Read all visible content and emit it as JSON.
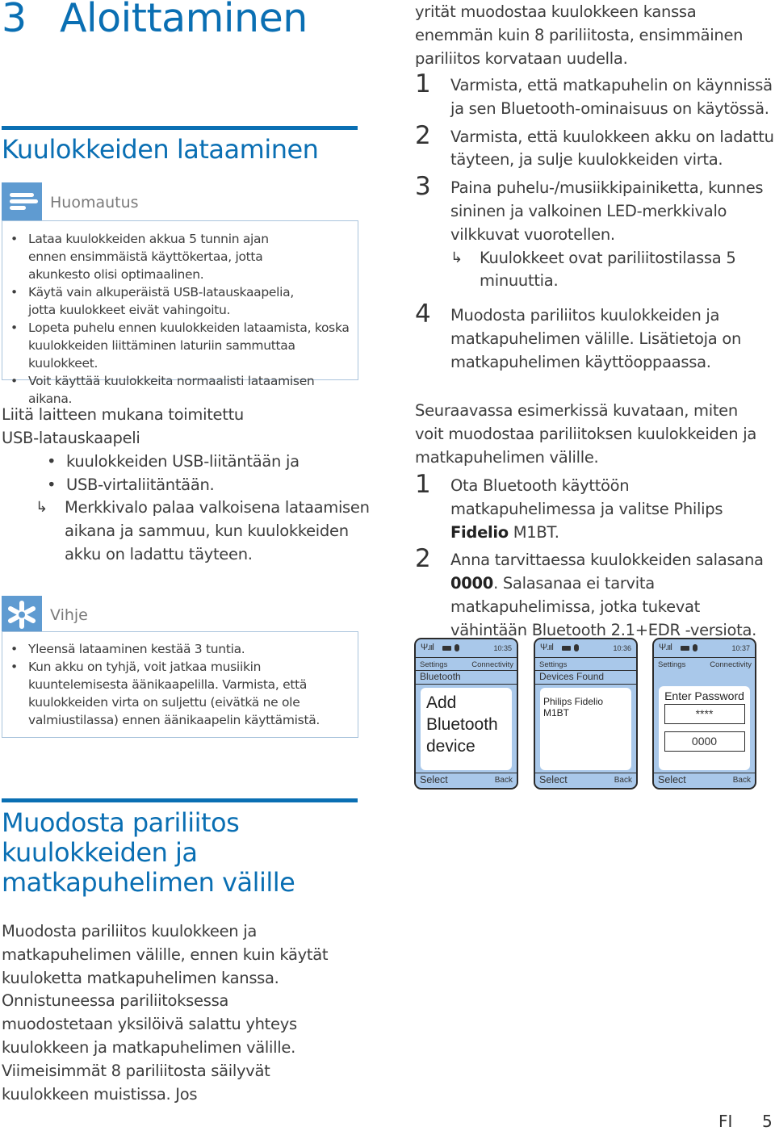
{
  "chapter": {
    "number": "3",
    "title": "Aloittaminen"
  },
  "accent_color": "#0a6fb3",
  "charging": {
    "heading": "Kuulokkeiden lataaminen",
    "note": {
      "icon": "note-lines-icon",
      "label": "Huomautus",
      "items": [
        "Lataa kuulokkeiden akkua 5 tunnin ajan ennen ensimmäistä käyttökertaa, jotta akunkesto olisi optimaalinen.",
        "Käytä vain alkuperäistä USB-latauskaapelia, jotta kuulokkeet eivät vahingoitu.",
        "Lopeta puhelu ennen kuulokkeiden lataamista, koska kuulokkeiden liittäminen laturiin sammuttaa kuulokkeet.",
        "Voit käyttää kuulokkeita normaalisti lataamisen aikana."
      ]
    },
    "intro": "Liitä laitteen mukana toimitettu USB-latauskaapeli",
    "bullets": [
      "kuulokkeiden USB-liitäntään ja",
      "USB-virtaliitäntään."
    ],
    "result": "Merkkivalo palaa valkoisena lataamisen aikana ja sammuu, kun kuulokkeiden akku on ladattu täyteen.",
    "tip": {
      "icon": "asterisk-tip-icon",
      "label": "Vihje",
      "items": [
        "Yleensä lataaminen kestää 3 tuntia.",
        "Kun akku on tyhjä, voit jatkaa musiikin kuuntelemisesta äänikaapelilla. Varmista, että kuulokkeiden virta on suljettu (eivätkä ne ole valmiustilassa) ennen äänikaapelin käyttämistä."
      ]
    }
  },
  "pairing": {
    "heading": "Muodosta pariliitos kuulokkeiden ja matkapuhelimen välille",
    "intro": "Muodosta pariliitos kuulokkeen ja matkapuhelimen välille, ennen kuin käytät kuuloketta matkapuhelimen kanssa. Onnistuneessa pariliitoksessa muodostetaan yksilöivä salattu yhteys kuulokkeen ja matkapuhelimen välille. Viimeisimmät 8 pariliitosta säilyvät kuulokkeen muistissa. Jos",
    "continuation": "yrität muodostaa kuulokkeen kanssa enemmän kuin 8 pariliitosta, ensimmäinen pariliitos korvataan uudella.",
    "steps": [
      {
        "n": "1",
        "text": "Varmista, että matkapuhelin on käynnissä ja sen Bluetooth-ominaisuus on käytössä."
      },
      {
        "n": "2",
        "text": "Varmista, että kuulokkeen akku on ladattu täyteen, ja sulje kuulokkeiden virta."
      },
      {
        "n": "3",
        "text": "Paina puhelu-/musiikkipainiketta, kunnes sininen ja valkoinen LED-merkkivalo vilkkuvat vuorotellen.",
        "result": "Kuulokkeet ovat pariliitostilassa 5 minuuttia."
      },
      {
        "n": "4",
        "text": "Muodosta pariliitos kuulokkeiden ja matkapuhelimen välille. Lisätietoja on matkapuhelimen käyttöoppaassa."
      }
    ],
    "example_intro": "Seuraavassa esimerkissä kuvataan, miten voit muodostaa pariliitoksen kuulokkeiden ja matkapuhelimen välille.",
    "example_steps": [
      {
        "n": "1",
        "pre": "Ota Bluetooth käyttöön matkapuhelimessa ja valitse Philips ",
        "bold": "Fidelio",
        "post": " M1BT."
      },
      {
        "n": "2",
        "pre": "Anna tarvittaessa kuulokkeiden salasana ",
        "bold": "0000",
        "post": ". Salasanaa ei tarvita matkapuhelimissa, jotka tukevat vähintään Bluetooth 2.1+EDR -versiota."
      }
    ]
  },
  "phones": [
    {
      "time": "10:35",
      "menu_left": "Settings",
      "menu_right": "Connectivity",
      "sub": "Bluetooth",
      "screen_text": [
        "Add",
        "Bluetooth",
        "device"
      ],
      "softkey_left": "Select",
      "softkey_right": "Back"
    },
    {
      "time": "10:36",
      "menu_left": "Settings",
      "menu_right": "",
      "sub": "Devices Found",
      "screen_text": [
        "Philips Fidelio M1BT"
      ],
      "softkey_left": "Select",
      "softkey_right": "Back"
    },
    {
      "time": "10:37",
      "menu_left": "Settings",
      "menu_right": "Connectivity",
      "sub": "",
      "screen_title": "Enter Password",
      "masked": "****",
      "password": "0000",
      "softkey_left": "Select",
      "softkey_right": "Back"
    }
  ],
  "footer": {
    "language": "FI",
    "page": "5"
  }
}
